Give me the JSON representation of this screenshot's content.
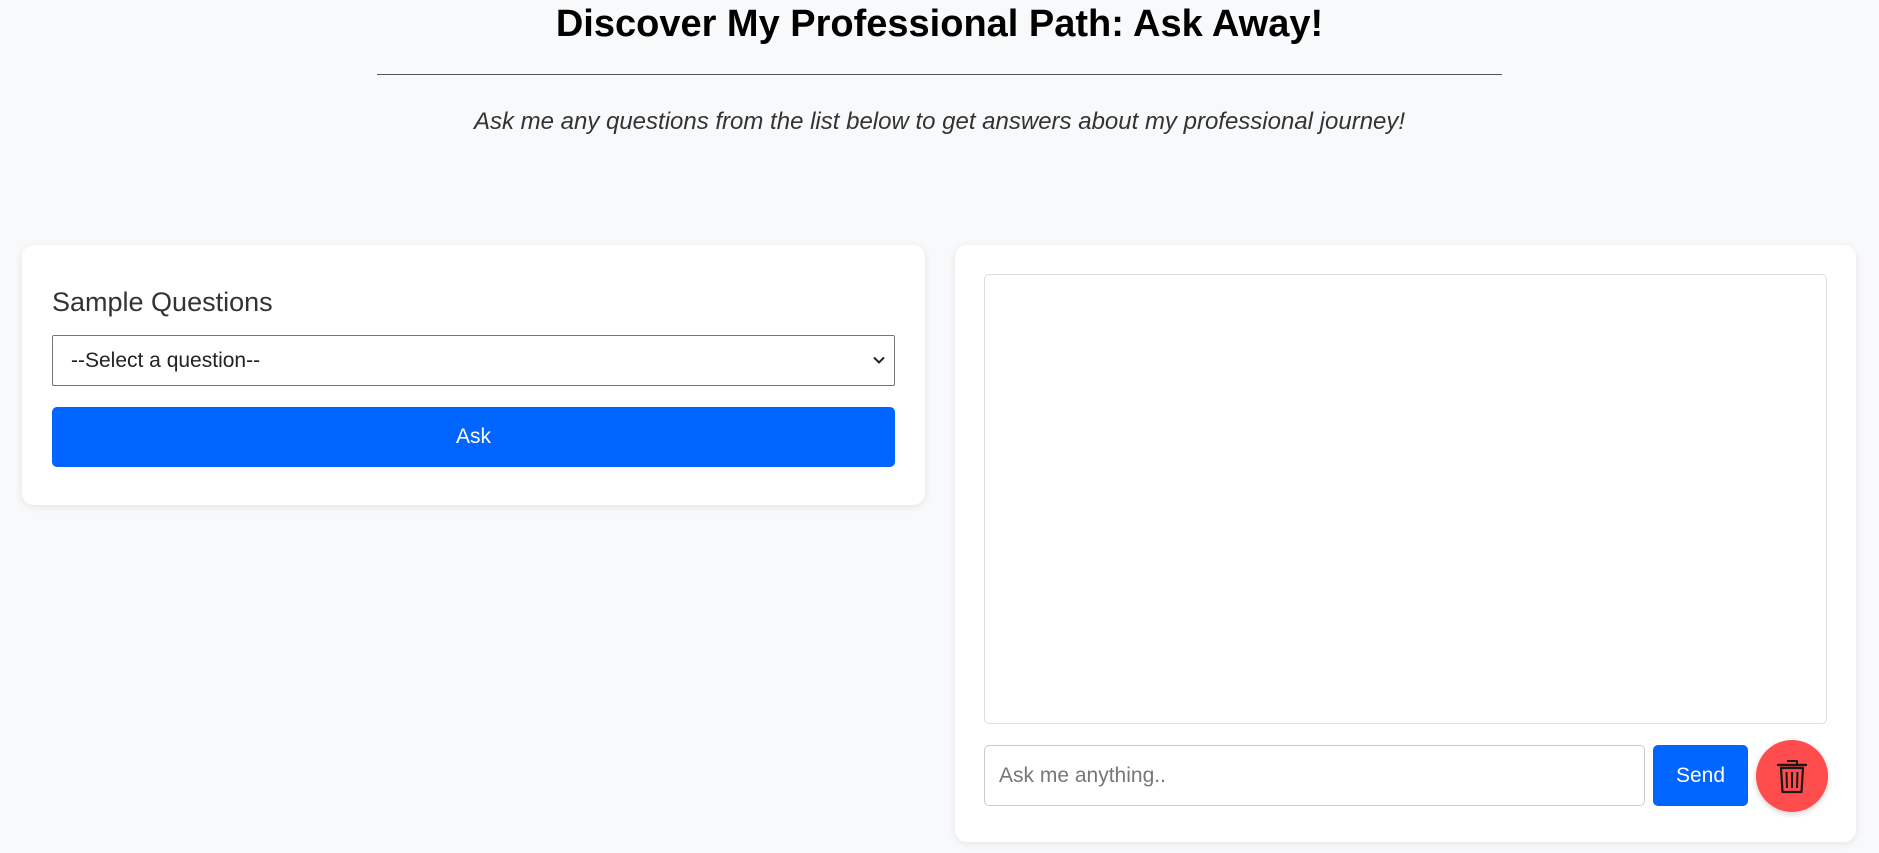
{
  "header": {
    "title": "Discover My Professional Path: Ask Away!",
    "subtitle": "Ask me any questions from the list below to get answers about my professional journey!"
  },
  "sample_questions": {
    "heading": "Sample Questions",
    "select_value": "--Select a question--",
    "ask_label": "Ask"
  },
  "chat": {
    "input_placeholder": "Ask me anything..",
    "send_label": "Send",
    "clear_icon": "trash-icon"
  },
  "colors": {
    "background": "#f8f9fa",
    "primary": "#0066ff",
    "danger": "#ff4d4d",
    "card": "#ffffff"
  }
}
